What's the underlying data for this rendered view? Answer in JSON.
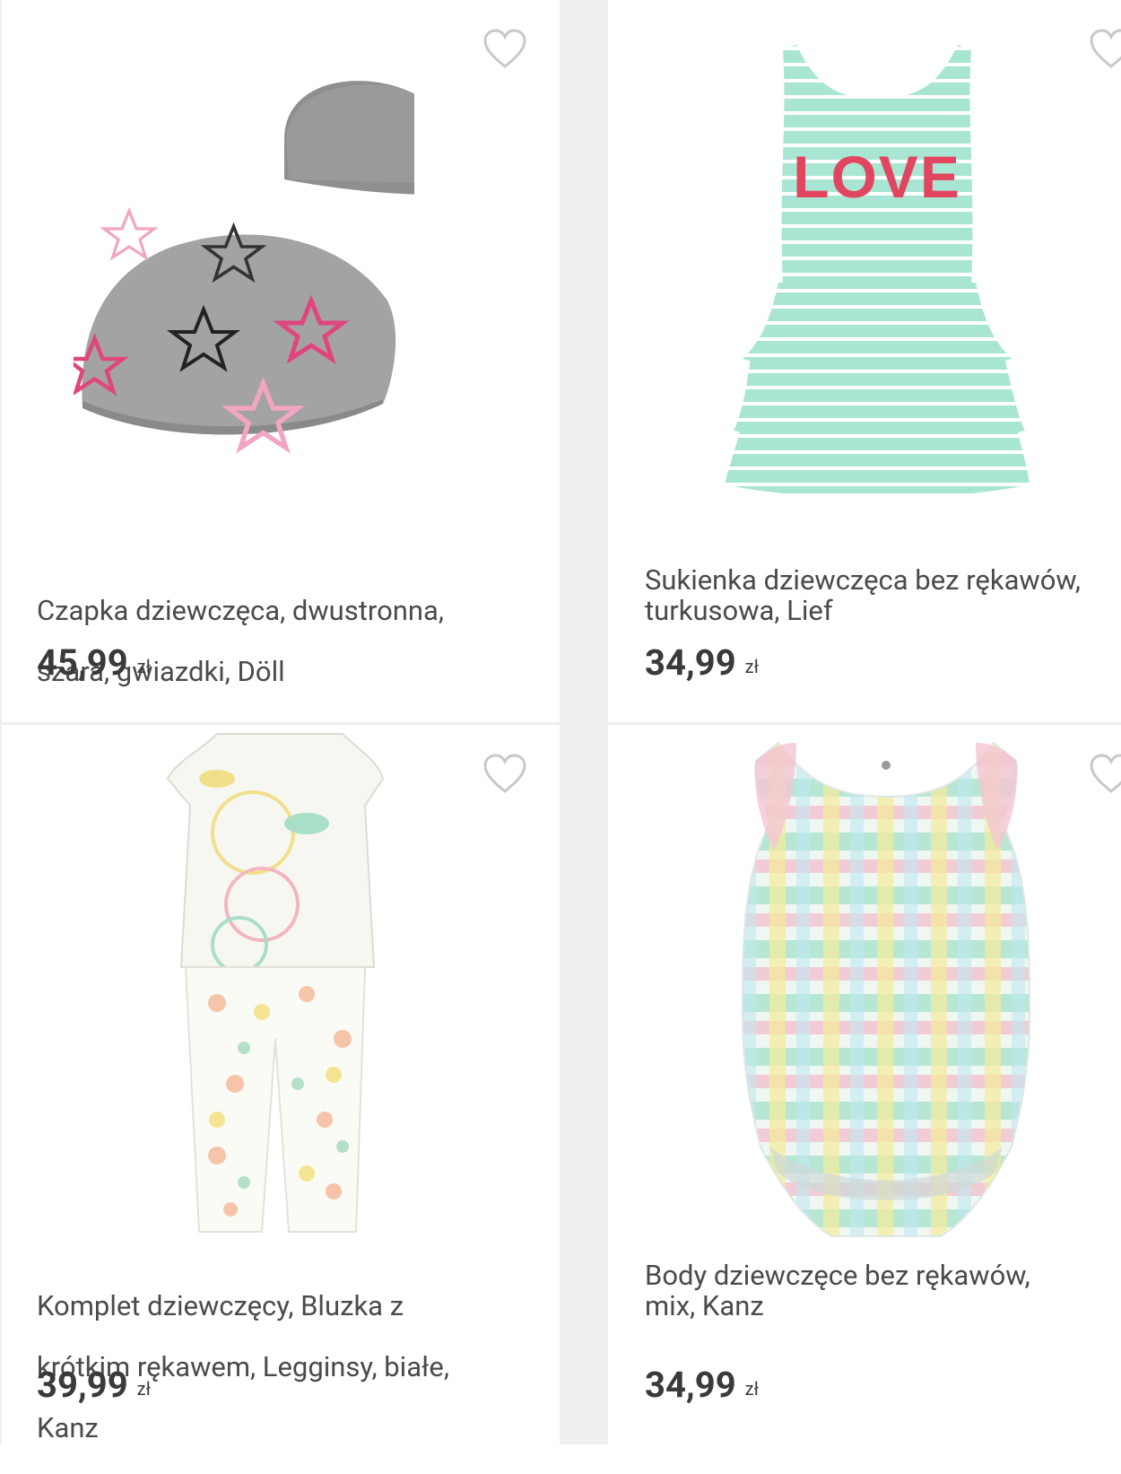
{
  "products": [
    {
      "title_line1": "Czapka dziewczęca, dwustronna,",
      "title_line2": "szara, gwiazdki, Döll",
      "price": "45,99",
      "currency": "zł",
      "image": "grey-star-beanie",
      "wishlist_icon": "heart-outline-icon"
    },
    {
      "title_line1": "Sukienka dziewczęca bez rękawów,",
      "title_line2": "turkusowa, Lief",
      "price": "34,99",
      "currency": "zł",
      "image": "mint-striped-love-dress",
      "print_text": "LOVE",
      "wishlist_icon": "heart-outline-icon"
    },
    {
      "title_line1": "Komplet dziewczęcy, Bluzka z",
      "title_line2": "krótkim rękawem, Legginsy, białe,",
      "title_line3": "Kanz",
      "price": "39,99",
      "currency": "zł",
      "image": "white-floral-set",
      "wishlist_icon": "heart-outline-icon"
    },
    {
      "title_line1": "Body dziewczęce bez rękawów,",
      "title_line2": "mix, Kanz",
      "price": "34,99",
      "currency": "zł",
      "image": "pastel-plaid-romper",
      "wishlist_icon": "heart-outline-icon"
    }
  ],
  "colors": {
    "text": "#4a4a4a",
    "price": "#3a3a3a",
    "divider": "#efefef",
    "heart": "#c8c8c8"
  }
}
